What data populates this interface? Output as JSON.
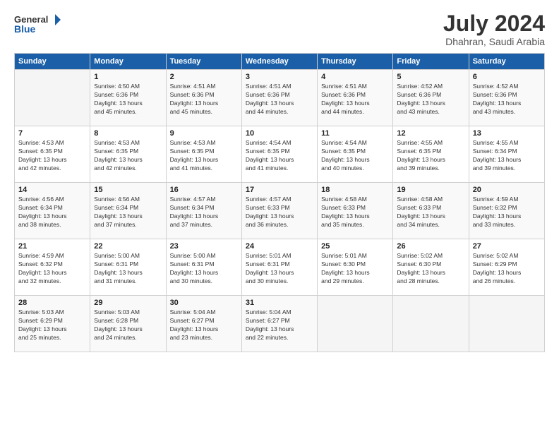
{
  "header": {
    "logo_line1": "General",
    "logo_line2": "Blue",
    "title": "July 2024",
    "location": "Dhahran, Saudi Arabia"
  },
  "weekdays": [
    "Sunday",
    "Monday",
    "Tuesday",
    "Wednesday",
    "Thursday",
    "Friday",
    "Saturday"
  ],
  "weeks": [
    [
      {
        "day": "",
        "info": ""
      },
      {
        "day": "1",
        "info": "Sunrise: 4:50 AM\nSunset: 6:36 PM\nDaylight: 13 hours\nand 45 minutes."
      },
      {
        "day": "2",
        "info": "Sunrise: 4:51 AM\nSunset: 6:36 PM\nDaylight: 13 hours\nand 45 minutes."
      },
      {
        "day": "3",
        "info": "Sunrise: 4:51 AM\nSunset: 6:36 PM\nDaylight: 13 hours\nand 44 minutes."
      },
      {
        "day": "4",
        "info": "Sunrise: 4:51 AM\nSunset: 6:36 PM\nDaylight: 13 hours\nand 44 minutes."
      },
      {
        "day": "5",
        "info": "Sunrise: 4:52 AM\nSunset: 6:36 PM\nDaylight: 13 hours\nand 43 minutes."
      },
      {
        "day": "6",
        "info": "Sunrise: 4:52 AM\nSunset: 6:36 PM\nDaylight: 13 hours\nand 43 minutes."
      }
    ],
    [
      {
        "day": "7",
        "info": "Sunrise: 4:53 AM\nSunset: 6:35 PM\nDaylight: 13 hours\nand 42 minutes."
      },
      {
        "day": "8",
        "info": "Sunrise: 4:53 AM\nSunset: 6:35 PM\nDaylight: 13 hours\nand 42 minutes."
      },
      {
        "day": "9",
        "info": "Sunrise: 4:53 AM\nSunset: 6:35 PM\nDaylight: 13 hours\nand 41 minutes."
      },
      {
        "day": "10",
        "info": "Sunrise: 4:54 AM\nSunset: 6:35 PM\nDaylight: 13 hours\nand 41 minutes."
      },
      {
        "day": "11",
        "info": "Sunrise: 4:54 AM\nSunset: 6:35 PM\nDaylight: 13 hours\nand 40 minutes."
      },
      {
        "day": "12",
        "info": "Sunrise: 4:55 AM\nSunset: 6:35 PM\nDaylight: 13 hours\nand 39 minutes."
      },
      {
        "day": "13",
        "info": "Sunrise: 4:55 AM\nSunset: 6:34 PM\nDaylight: 13 hours\nand 39 minutes."
      }
    ],
    [
      {
        "day": "14",
        "info": "Sunrise: 4:56 AM\nSunset: 6:34 PM\nDaylight: 13 hours\nand 38 minutes."
      },
      {
        "day": "15",
        "info": "Sunrise: 4:56 AM\nSunset: 6:34 PM\nDaylight: 13 hours\nand 37 minutes."
      },
      {
        "day": "16",
        "info": "Sunrise: 4:57 AM\nSunset: 6:34 PM\nDaylight: 13 hours\nand 37 minutes."
      },
      {
        "day": "17",
        "info": "Sunrise: 4:57 AM\nSunset: 6:33 PM\nDaylight: 13 hours\nand 36 minutes."
      },
      {
        "day": "18",
        "info": "Sunrise: 4:58 AM\nSunset: 6:33 PM\nDaylight: 13 hours\nand 35 minutes."
      },
      {
        "day": "19",
        "info": "Sunrise: 4:58 AM\nSunset: 6:33 PM\nDaylight: 13 hours\nand 34 minutes."
      },
      {
        "day": "20",
        "info": "Sunrise: 4:59 AM\nSunset: 6:32 PM\nDaylight: 13 hours\nand 33 minutes."
      }
    ],
    [
      {
        "day": "21",
        "info": "Sunrise: 4:59 AM\nSunset: 6:32 PM\nDaylight: 13 hours\nand 32 minutes."
      },
      {
        "day": "22",
        "info": "Sunrise: 5:00 AM\nSunset: 6:31 PM\nDaylight: 13 hours\nand 31 minutes."
      },
      {
        "day": "23",
        "info": "Sunrise: 5:00 AM\nSunset: 6:31 PM\nDaylight: 13 hours\nand 30 minutes."
      },
      {
        "day": "24",
        "info": "Sunrise: 5:01 AM\nSunset: 6:31 PM\nDaylight: 13 hours\nand 30 minutes."
      },
      {
        "day": "25",
        "info": "Sunrise: 5:01 AM\nSunset: 6:30 PM\nDaylight: 13 hours\nand 29 minutes."
      },
      {
        "day": "26",
        "info": "Sunrise: 5:02 AM\nSunset: 6:30 PM\nDaylight: 13 hours\nand 28 minutes."
      },
      {
        "day": "27",
        "info": "Sunrise: 5:02 AM\nSunset: 6:29 PM\nDaylight: 13 hours\nand 26 minutes."
      }
    ],
    [
      {
        "day": "28",
        "info": "Sunrise: 5:03 AM\nSunset: 6:29 PM\nDaylight: 13 hours\nand 25 minutes."
      },
      {
        "day": "29",
        "info": "Sunrise: 5:03 AM\nSunset: 6:28 PM\nDaylight: 13 hours\nand 24 minutes."
      },
      {
        "day": "30",
        "info": "Sunrise: 5:04 AM\nSunset: 6:27 PM\nDaylight: 13 hours\nand 23 minutes."
      },
      {
        "day": "31",
        "info": "Sunrise: 5:04 AM\nSunset: 6:27 PM\nDaylight: 13 hours\nand 22 minutes."
      },
      {
        "day": "",
        "info": ""
      },
      {
        "day": "",
        "info": ""
      },
      {
        "day": "",
        "info": ""
      }
    ]
  ]
}
